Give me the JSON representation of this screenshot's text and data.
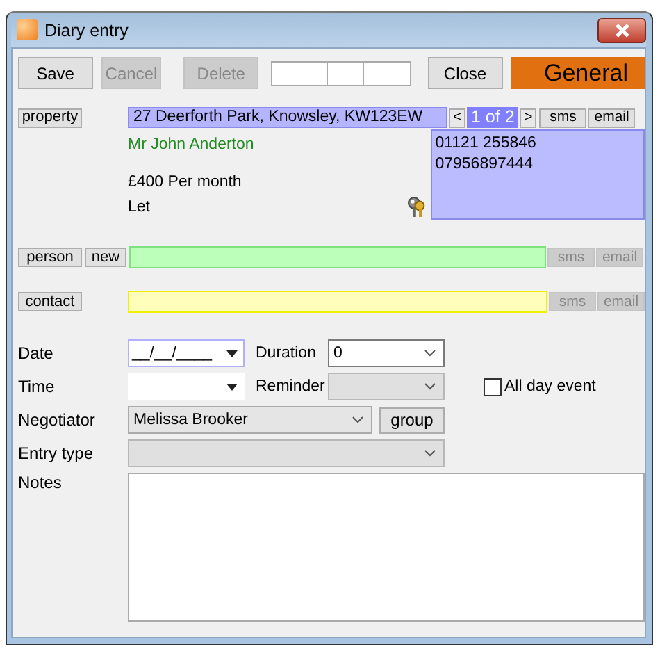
{
  "window": {
    "title": "Diary entry"
  },
  "toolbar": {
    "buttons": [
      {
        "label": "Save",
        "disabled": false
      },
      {
        "label": "Cancel",
        "disabled": true
      },
      {
        "label": "Delete",
        "disabled": true
      }
    ],
    "close": "Close",
    "category": "General"
  },
  "property": {
    "button": "property",
    "address": "27 Deerforth Park, Knowsley, KW123EW",
    "pager": {
      "prev": "<",
      "label": "1 of 2",
      "next": ">"
    },
    "actions": [
      {
        "label": "sms",
        "disabled": false
      },
      {
        "label": "email",
        "disabled": false
      }
    ],
    "contact_name": "Mr John Anderton",
    "phones": [
      "01121 255846",
      "07956897444"
    ],
    "rent": "£400 Per month",
    "status": "Let"
  },
  "person": {
    "button": "person",
    "new_button": "new",
    "actions": [
      {
        "label": "sms",
        "disabled": true
      },
      {
        "label": "email",
        "disabled": true
      }
    ]
  },
  "contact": {
    "button": "contact",
    "actions": [
      {
        "label": "sms",
        "disabled": true
      },
      {
        "label": "email",
        "disabled": true
      }
    ]
  },
  "form": {
    "date": {
      "label": "Date",
      "value": "__/__/____"
    },
    "duration": {
      "label": "Duration",
      "value": "0",
      "disabled": false
    },
    "time": {
      "label": "Time"
    },
    "reminder": {
      "label": "Reminder",
      "disabled": true
    },
    "all_day": {
      "label": "All day event",
      "checked": false
    },
    "negotiator": {
      "label": "Negotiator",
      "value": "Melissa Brooker"
    },
    "group_button": "group",
    "entry_type": {
      "label": "Entry type",
      "disabled": true
    },
    "notes": {
      "label": "Notes"
    }
  }
}
